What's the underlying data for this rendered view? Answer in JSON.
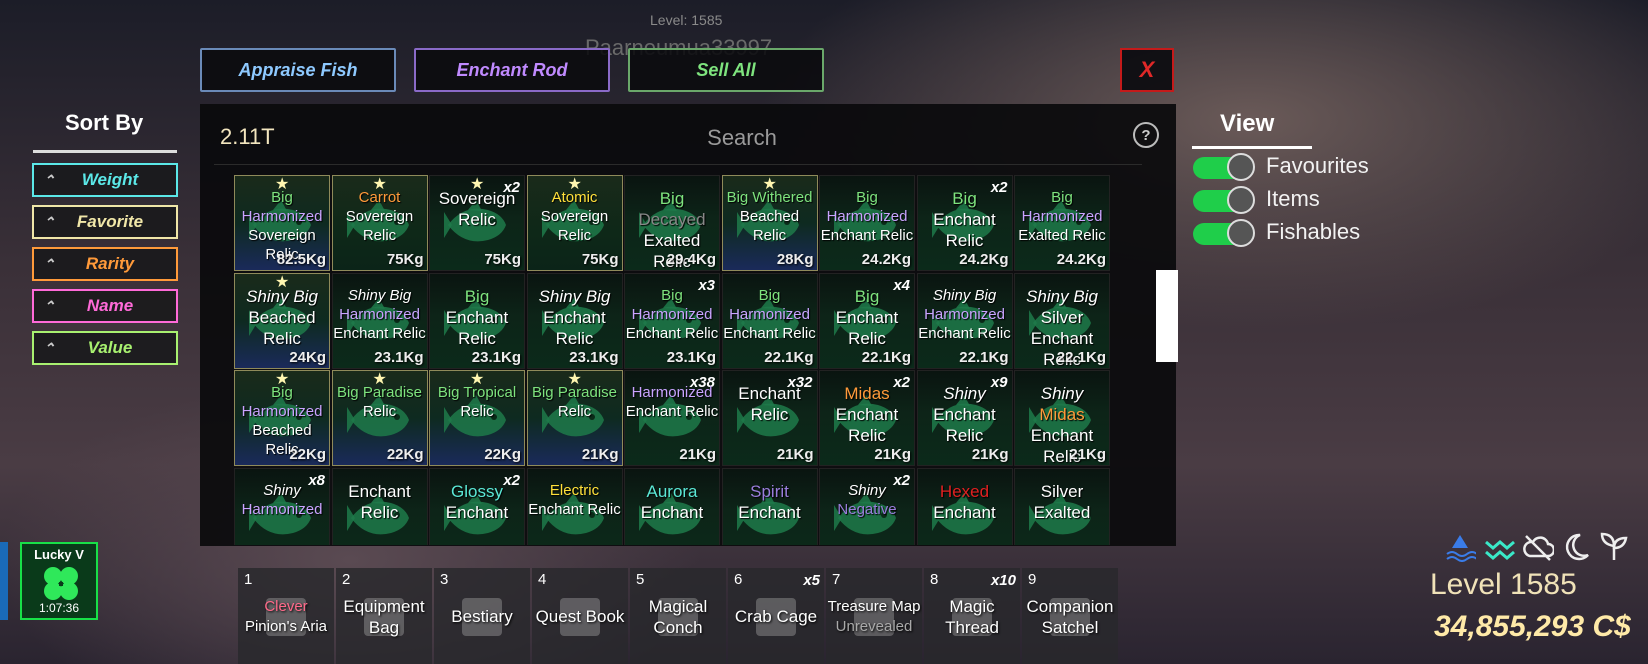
{
  "background_text": {
    "level": "Level: 1585",
    "player": "Paarneumua33997"
  },
  "top_buttons": [
    {
      "label": "Appraise Fish",
      "color": "#8ec9ff",
      "border": "#6a8ab8"
    },
    {
      "label": "Enchant Rod",
      "color": "#c08aff",
      "border": "#8a6ac8"
    },
    {
      "label": "Sell All",
      "color": "#7ee37e",
      "border": "#6aa86a"
    }
  ],
  "close_label": "X",
  "currency": "2.11T",
  "search": {
    "placeholder": "Search"
  },
  "help_label": "?",
  "sort": {
    "title": "Sort By",
    "options": [
      {
        "label": "Weight",
        "color": "#5be8e8",
        "arrow": "⌃"
      },
      {
        "label": "Favorite",
        "color": "#f0e6a8",
        "arrow": "⌃"
      },
      {
        "label": "Rarity",
        "color": "#ff9a3a",
        "arrow": "⌃"
      },
      {
        "label": "Name",
        "color": "#ff6ad8",
        "arrow": "⌃"
      },
      {
        "label": "Value",
        "color": "#a8f070",
        "arrow": "⌃"
      }
    ]
  },
  "view": {
    "title": "View",
    "toggles": [
      {
        "label": "Favourites",
        "on": true
      },
      {
        "label": "Items",
        "on": true
      },
      {
        "label": "Fishables",
        "on": true
      }
    ]
  },
  "inventory": [
    {
      "lines": [
        [
          "Big",
          "c-g"
        ],
        [
          "Harmonized",
          "c-p"
        ],
        [
          "Sovereign",
          "w"
        ],
        [
          "Relic",
          "w"
        ]
      ],
      "weight": "82.5Kg",
      "star": true,
      "style": "goldblue"
    },
    {
      "lines": [
        [
          "Carrot",
          "c-o"
        ],
        [
          "Sovereign",
          "w"
        ],
        [
          "Relic",
          "w"
        ]
      ],
      "weight": "75Kg",
      "star": true,
      "style": "gold"
    },
    {
      "lines": [
        [
          "Sovereign",
          "w"
        ],
        [
          "Relic",
          "w"
        ]
      ],
      "weight": "75Kg",
      "star": true,
      "count": "x2",
      "big": true
    },
    {
      "lines": [
        [
          "Atomic",
          "c-y"
        ],
        [
          "Sovereign",
          "w"
        ],
        [
          "Relic",
          "w"
        ]
      ],
      "weight": "75Kg",
      "star": true,
      "style": "gold"
    },
    {
      "lines": [
        [
          "Big",
          "c-g"
        ],
        [
          "Decayed",
          "c-d"
        ],
        [
          "Exalted",
          "w"
        ],
        [
          "Relic",
          "w"
        ]
      ],
      "weight": "29.4Kg",
      "big": true
    },
    {
      "lines": [
        [
          "Big Withered",
          "c-g"
        ],
        [
          "Beached",
          "w"
        ],
        [
          "Relic",
          "w"
        ]
      ],
      "weight": "28Kg",
      "star": true,
      "style": "goldblue"
    },
    {
      "lines": [
        [
          "Big",
          "c-g"
        ],
        [
          "Harmonized",
          "c-p"
        ],
        [
          "Enchant Relic",
          "w"
        ]
      ],
      "weight": "24.2Kg"
    },
    {
      "lines": [
        [
          "Big",
          "c-g"
        ],
        [
          "Enchant",
          "w"
        ],
        [
          "Relic",
          "w"
        ]
      ],
      "weight": "24.2Kg",
      "count": "x2",
      "big": true
    },
    {
      "lines": [
        [
          "Big",
          "c-g"
        ],
        [
          "Harmonized",
          "c-p"
        ],
        [
          "Exalted Relic",
          "w"
        ]
      ],
      "weight": "24.2Kg"
    },
    {
      "lines": [
        [
          "Shiny Big",
          "i"
        ],
        [
          "Beached",
          "w"
        ],
        [
          "Relic",
          "w"
        ]
      ],
      "weight": "24Kg",
      "star": true,
      "style": "goldblue",
      "big": true
    },
    {
      "lines": [
        [
          "Shiny Big",
          "i"
        ],
        [
          "Harmonized",
          "c-p"
        ],
        [
          "Enchant Relic",
          "w"
        ]
      ],
      "weight": "23.1Kg"
    },
    {
      "lines": [
        [
          "Big",
          "c-g"
        ],
        [
          "Enchant",
          "w"
        ],
        [
          "Relic",
          "w"
        ]
      ],
      "weight": "23.1Kg",
      "big": true
    },
    {
      "lines": [
        [
          "Shiny Big",
          "i"
        ],
        [
          "Enchant",
          "w"
        ],
        [
          "Relic",
          "w"
        ]
      ],
      "weight": "23.1Kg",
      "big": true
    },
    {
      "lines": [
        [
          "Big",
          "c-g"
        ],
        [
          "Harmonized",
          "c-p"
        ],
        [
          "Enchant Relic",
          "w"
        ]
      ],
      "weight": "23.1Kg",
      "count": "x3"
    },
    {
      "lines": [
        [
          "Big",
          "c-g"
        ],
        [
          "Harmonized",
          "c-p"
        ],
        [
          "Enchant Relic",
          "w"
        ]
      ],
      "weight": "22.1Kg"
    },
    {
      "lines": [
        [
          "Big",
          "c-g"
        ],
        [
          "Enchant",
          "w"
        ],
        [
          "Relic",
          "w"
        ]
      ],
      "weight": "22.1Kg",
      "count": "x4",
      "big": true
    },
    {
      "lines": [
        [
          "Shiny Big",
          "i"
        ],
        [
          "Harmonized",
          "c-p"
        ],
        [
          "Enchant Relic",
          "w"
        ]
      ],
      "weight": "22.1Kg"
    },
    {
      "lines": [
        [
          "Shiny Big",
          "i"
        ],
        [
          "Silver",
          "w"
        ],
        [
          "Enchant",
          "w"
        ],
        [
          "Relic",
          "w"
        ]
      ],
      "weight": "22.1Kg",
      "big": true
    },
    {
      "lines": [
        [
          "Big",
          "c-g"
        ],
        [
          "Harmonized",
          "c-p"
        ],
        [
          "Beached",
          "w"
        ],
        [
          "Relic",
          "w"
        ]
      ],
      "weight": "22Kg",
      "star": true,
      "style": "goldblue"
    },
    {
      "lines": [
        [
          "Big Paradise",
          "c-g"
        ],
        [
          "Relic",
          "w"
        ]
      ],
      "weight": "22Kg",
      "star": true,
      "style": "goldblue"
    },
    {
      "lines": [
        [
          "Big Tropical",
          "c-g"
        ],
        [
          "Relic",
          "w"
        ]
      ],
      "weight": "22Kg",
      "star": true,
      "style": "goldblue"
    },
    {
      "lines": [
        [
          "Big Paradise",
          "c-g"
        ],
        [
          "Relic",
          "w"
        ]
      ],
      "weight": "21Kg",
      "star": true,
      "style": "goldblue"
    },
    {
      "lines": [
        [
          "Harmonized",
          "c-p"
        ],
        [
          "Enchant Relic",
          "w"
        ]
      ],
      "weight": "21Kg",
      "count": "x38"
    },
    {
      "lines": [
        [
          "Enchant",
          "w"
        ],
        [
          "Relic",
          "w"
        ]
      ],
      "weight": "21Kg",
      "count": "x32",
      "big": true
    },
    {
      "lines": [
        [
          "Midas",
          "c-o"
        ],
        [
          "Enchant",
          "w"
        ],
        [
          "Relic",
          "w"
        ]
      ],
      "weight": "21Kg",
      "count": "x2",
      "big": true
    },
    {
      "lines": [
        [
          "Shiny",
          "i"
        ],
        [
          "Enchant",
          "w"
        ],
        [
          "Relic",
          "w"
        ]
      ],
      "weight": "21Kg",
      "count": "x9",
      "big": true
    },
    {
      "lines": [
        [
          "Shiny",
          "i"
        ],
        [
          "Midas",
          "c-o"
        ],
        [
          "Enchant",
          "w"
        ],
        [
          "Relic",
          "w"
        ]
      ],
      "weight": "21Kg",
      "big": true
    },
    {
      "lines": [
        [
          "Shiny",
          "i"
        ],
        [
          "Harmonized",
          "c-p"
        ]
      ],
      "weight": "",
      "count": "x8"
    },
    {
      "lines": [
        [
          "Enchant",
          "w"
        ],
        [
          "Relic",
          "w"
        ]
      ],
      "weight": "",
      "big": true
    },
    {
      "lines": [
        [
          "Glossy",
          "c-c"
        ],
        [
          "Enchant",
          "w"
        ]
      ],
      "weight": "",
      "count": "x2",
      "big": true
    },
    {
      "lines": [
        [
          "Electric",
          "c-y"
        ],
        [
          "Enchant Relic",
          "w"
        ]
      ],
      "weight": ""
    },
    {
      "lines": [
        [
          "Aurora",
          "c-c"
        ],
        [
          "Enchant",
          "w"
        ]
      ],
      "weight": "",
      "big": true
    },
    {
      "lines": [
        [
          "Spirit",
          "c-s"
        ],
        [
          "Enchant",
          "w"
        ]
      ],
      "weight": "",
      "big": true
    },
    {
      "lines": [
        [
          "Shiny",
          "i"
        ],
        [
          "Negative",
          "c-s"
        ]
      ],
      "weight": "",
      "count": "x2"
    },
    {
      "lines": [
        [
          "Hexed",
          "c-r"
        ],
        [
          "Enchant",
          "w"
        ]
      ],
      "weight": "",
      "big": true
    },
    {
      "lines": [
        [
          "Silver",
          "w"
        ],
        [
          "Exalted",
          "w"
        ]
      ],
      "weight": "",
      "big": true
    }
  ],
  "buff": {
    "label": "Lucky V",
    "time": "1:07:36"
  },
  "hotbar": [
    {
      "num": "1",
      "lines": [
        [
          "Clever",
          "#ff6a8a"
        ],
        [
          "Pinion's Aria",
          "#fff"
        ]
      ],
      "count": ""
    },
    {
      "num": "2",
      "lines": [
        [
          "Equipment",
          "#fff"
        ],
        [
          "Bag",
          "#fff"
        ]
      ],
      "count": ""
    },
    {
      "num": "3",
      "lines": [
        [
          "Bestiary",
          "#fff"
        ]
      ],
      "count": ""
    },
    {
      "num": "4",
      "lines": [
        [
          "Quest Book",
          "#fff"
        ]
      ],
      "count": ""
    },
    {
      "num": "5",
      "lines": [
        [
          "Magical",
          "#fff"
        ],
        [
          "Conch",
          "#fff"
        ]
      ],
      "count": ""
    },
    {
      "num": "6",
      "lines": [
        [
          "Crab Cage",
          "#fff"
        ]
      ],
      "count": "x5"
    },
    {
      "num": "7",
      "lines": [
        [
          "Treasure Map",
          "#fff"
        ],
        [
          "Unrevealed",
          "#aaa"
        ]
      ],
      "count": ""
    },
    {
      "num": "8",
      "lines": [
        [
          "Magic",
          "#fff"
        ],
        [
          "Thread",
          "#fff"
        ]
      ],
      "count": "x10"
    },
    {
      "num": "9",
      "lines": [
        [
          "Companion",
          "#fff"
        ],
        [
          "Satchel",
          "#fff"
        ]
      ],
      "count": ""
    }
  ],
  "hud": {
    "icons": [
      "water-icon",
      "wind-icon",
      "cloud-off-icon",
      "moon-icon",
      "sprout-icon"
    ],
    "level": "Level 1585",
    "money": "34,855,293 C$"
  }
}
